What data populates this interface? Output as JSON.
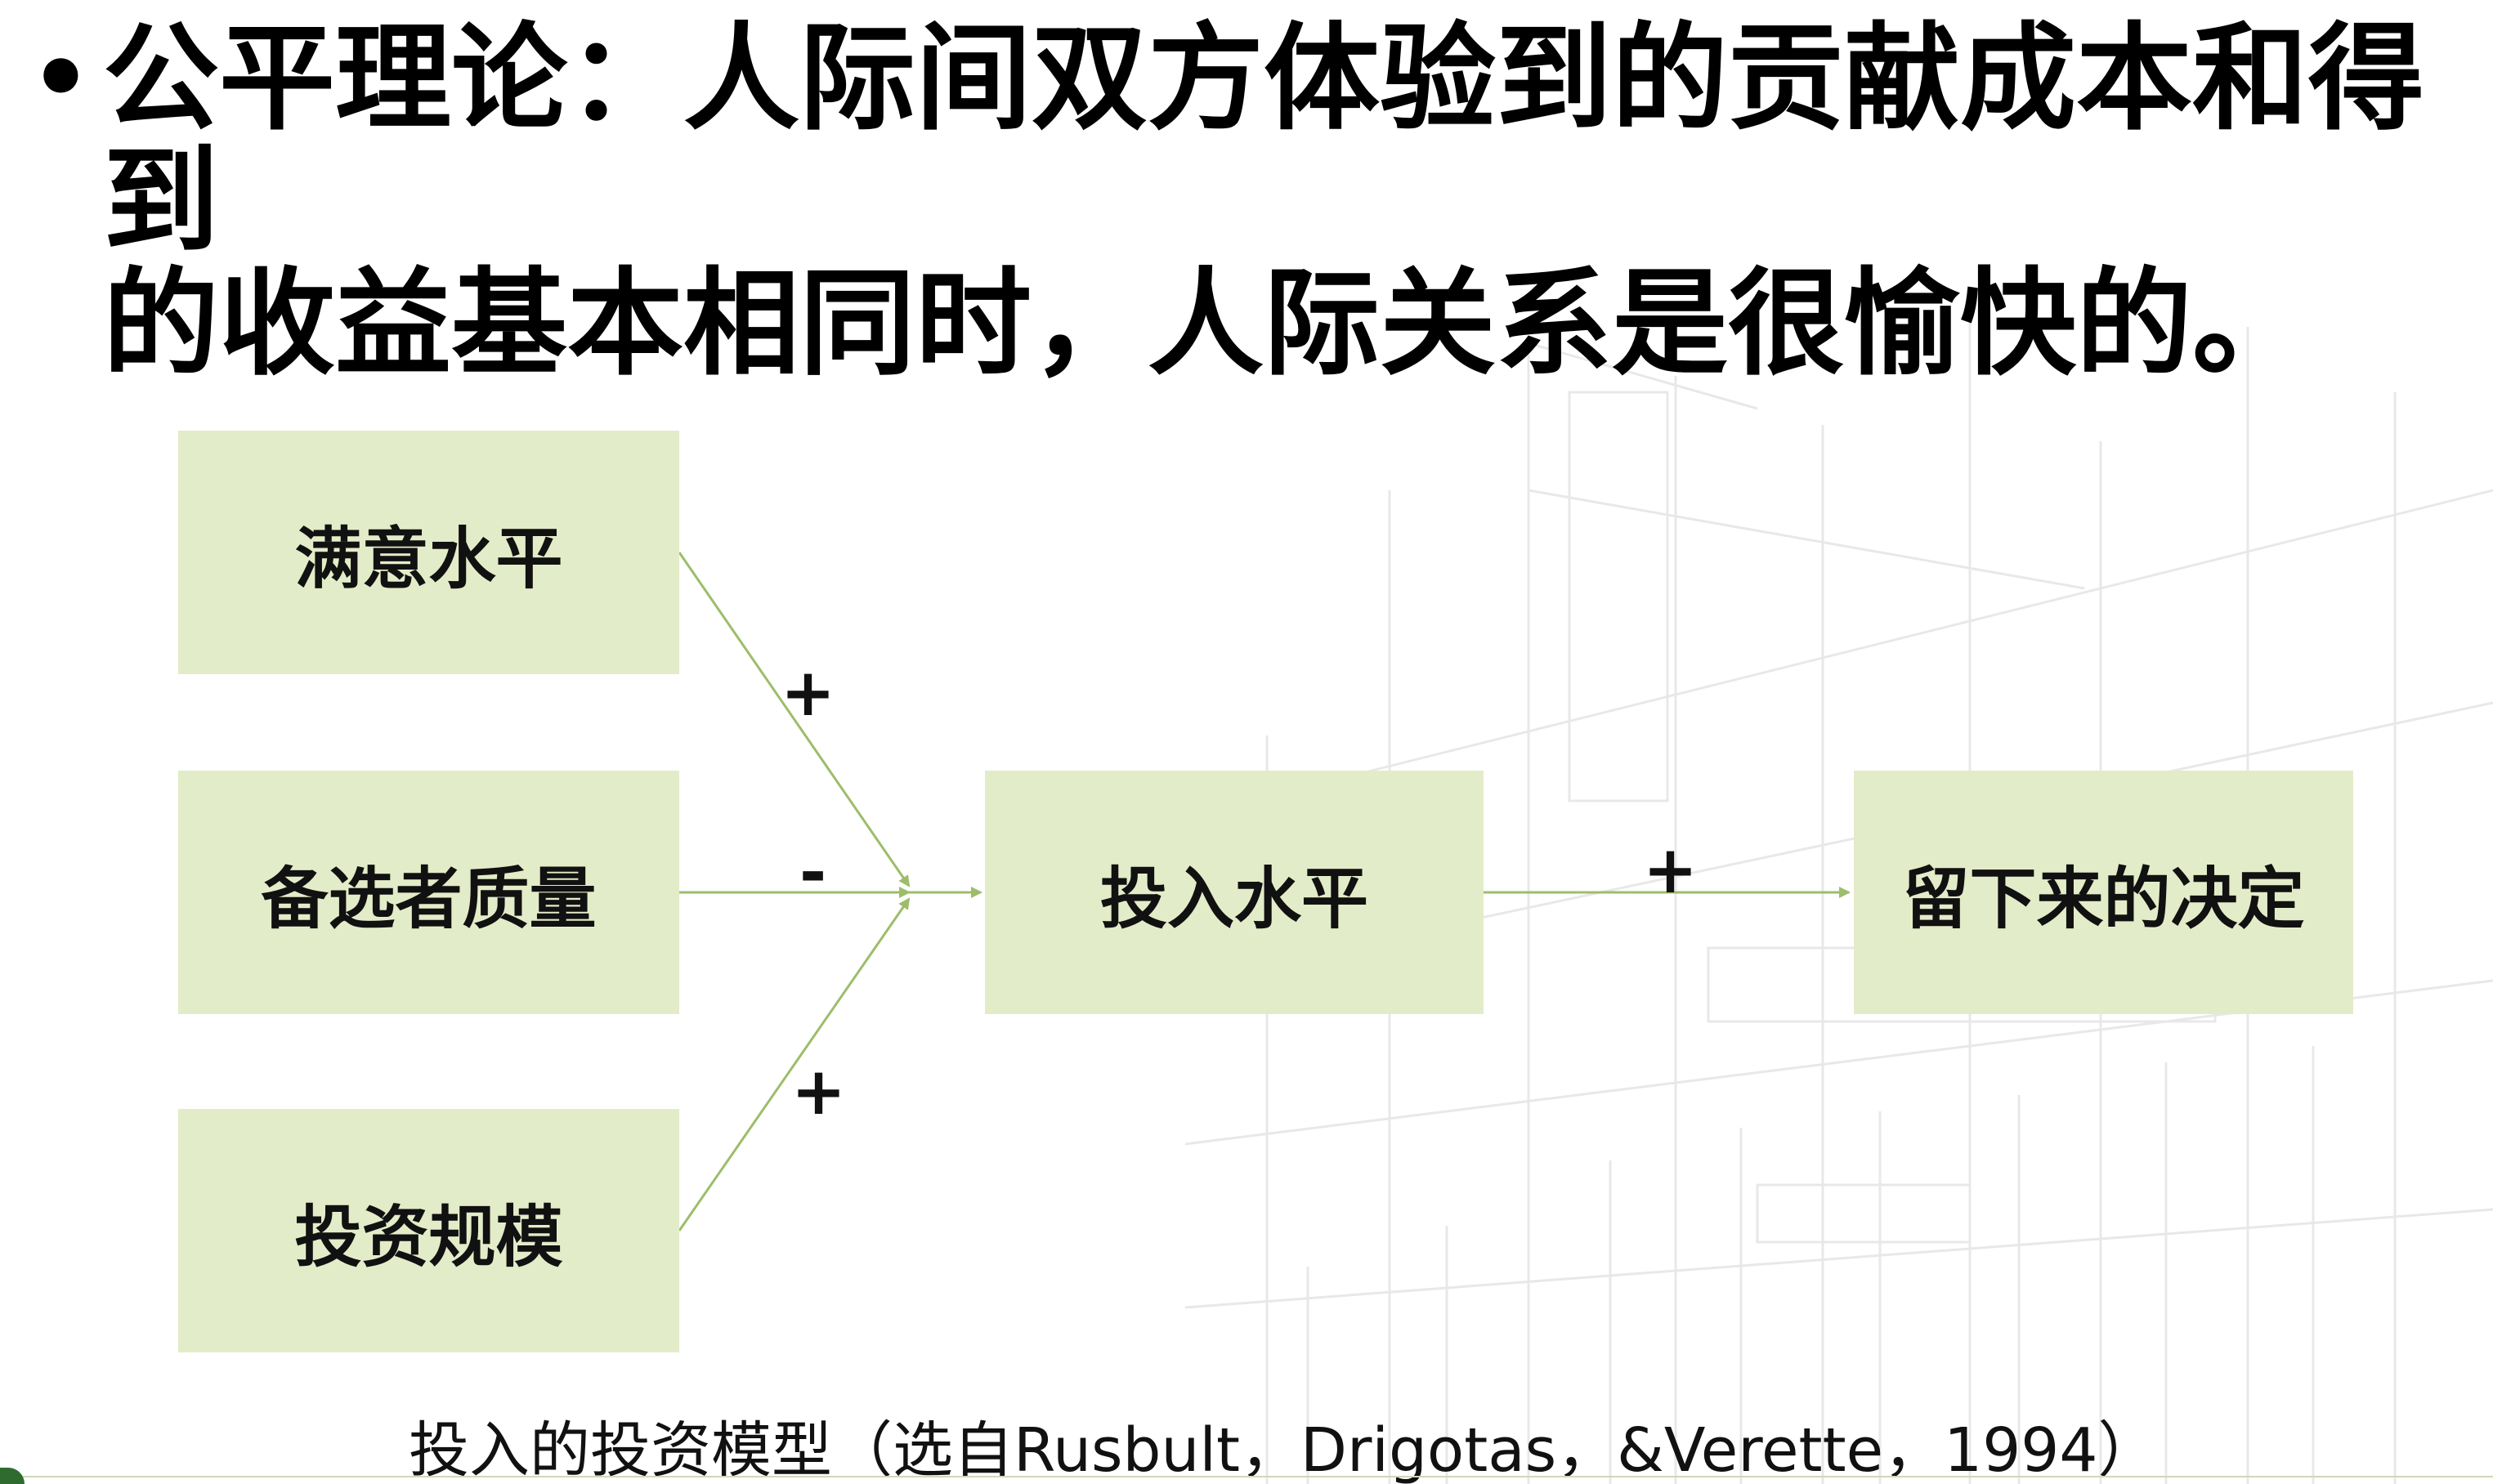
{
  "slide": {
    "bullet": {
      "symbol": "•",
      "line1": "公平理论：人际间双方体验到的贡献成本和得到",
      "line2": "的收益基本相同时，人际关系是很愉快的。"
    },
    "diagram": {
      "boxes": {
        "satisfaction": "满意水平",
        "alternatives": "备选者质量",
        "investment_size": "投资规模",
        "commitment": "投入水平",
        "stay_decision": "留下来的决定"
      },
      "signs": {
        "satisfaction": "+",
        "alternatives": "-",
        "investment_size": "+",
        "commitment": "+"
      },
      "colors": {
        "box_fill": "#e3ecc8",
        "arrow": "#9dbd6a"
      }
    },
    "caption": "投入的投资模型（选自Rusbult，Drigotas，&Verette，1994）"
  }
}
